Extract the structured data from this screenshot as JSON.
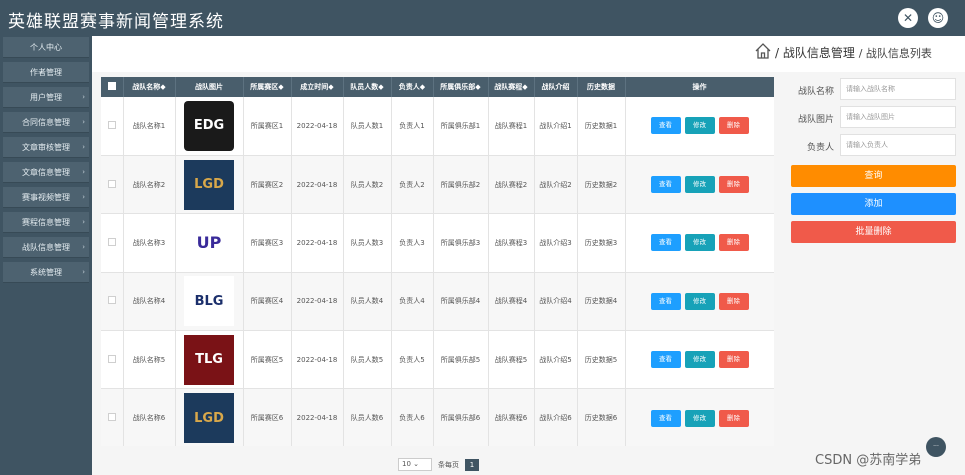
{
  "app": {
    "title": "英雄联盟赛事新闻管理系统"
  },
  "sidebar": {
    "items": [
      {
        "label": "个人中心",
        "chevron": false
      },
      {
        "label": "作者管理",
        "chevron": false
      },
      {
        "label": "用户管理",
        "chevron": true
      },
      {
        "label": "合同信息管理",
        "chevron": true
      },
      {
        "label": "文章审核管理",
        "chevron": true
      },
      {
        "label": "文章信息管理",
        "chevron": true
      },
      {
        "label": "赛事视频管理",
        "chevron": true
      },
      {
        "label": "赛程信息管理",
        "chevron": true
      },
      {
        "label": "战队信息管理",
        "chevron": true
      },
      {
        "label": "系统管理",
        "chevron": true
      }
    ]
  },
  "breadcrumb": {
    "section": "/ 战队信息管理",
    "page": "/ 战队信息列表"
  },
  "table": {
    "headers": [
      "战队名称◆",
      "战队图片",
      "所属赛区◆",
      "成立时间◆",
      "队员人数◆",
      "负责人◆",
      "所属俱乐部◆",
      "战队赛程◆",
      "战队介绍",
      "历史数据",
      "操作"
    ],
    "rows": [
      {
        "name": "战队名称1",
        "logo": "EDG",
        "region": "所属赛区1",
        "date": "2022-04-18",
        "members": "队员人数1",
        "leader": "负责人1",
        "club": "所属俱乐部1",
        "schedule": "战队赛程1",
        "intro": "战队介绍1",
        "history": "历史数据1"
      },
      {
        "name": "战队名称2",
        "logo": "LGD",
        "region": "所属赛区2",
        "date": "2022-04-18",
        "members": "队员人数2",
        "leader": "负责人2",
        "club": "所属俱乐部2",
        "schedule": "战队赛程2",
        "intro": "战队介绍2",
        "history": "历史数据2"
      },
      {
        "name": "战队名称3",
        "logo": "UP",
        "region": "所属赛区3",
        "date": "2022-04-18",
        "members": "队员人数3",
        "leader": "负责人3",
        "club": "所属俱乐部3",
        "schedule": "战队赛程3",
        "intro": "战队介绍3",
        "history": "历史数据3"
      },
      {
        "name": "战队名称4",
        "logo": "BLG",
        "region": "所属赛区4",
        "date": "2022-04-18",
        "members": "队员人数4",
        "leader": "负责人4",
        "club": "所属俱乐部4",
        "schedule": "战队赛程4",
        "intro": "战队介绍4",
        "history": "历史数据4"
      },
      {
        "name": "战队名称5",
        "logo": "TLG",
        "region": "所属赛区5",
        "date": "2022-04-18",
        "members": "队员人数5",
        "leader": "负责人5",
        "club": "所属俱乐部5",
        "schedule": "战队赛程5",
        "intro": "战队介绍5",
        "history": "历史数据5"
      },
      {
        "name": "战队名称6",
        "logo": "LGD",
        "region": "所属赛区6",
        "date": "2022-04-18",
        "members": "队员人数6",
        "leader": "负责人6",
        "club": "所属俱乐部6",
        "schedule": "战队赛程6",
        "intro": "战队介绍6",
        "history": "历史数据6"
      }
    ],
    "actions": {
      "view": "查看",
      "edit": "修改",
      "delete": "删除"
    }
  },
  "search": {
    "name_label": "战队名称",
    "name_placeholder": "请输入战队名称",
    "image_label": "战队图片",
    "image_placeholder": "请输入战队图片",
    "leader_label": "负责人",
    "leader_placeholder": "请输入负责人",
    "query_button": "查询",
    "add_button": "添加",
    "batch_delete_button": "批量删除"
  },
  "pagination": {
    "page_size": "10",
    "per_page_label": "条每页",
    "current_page": "1"
  },
  "watermark": "CSDN @苏南学弟",
  "colors": {
    "header": "#3f5462",
    "query": "#ff8c00",
    "add": "#1e90ff",
    "batch_delete": "#f05a4a",
    "view": "#1e9fff",
    "edit": "#17a2b8",
    "delete": "#f05a4a"
  }
}
